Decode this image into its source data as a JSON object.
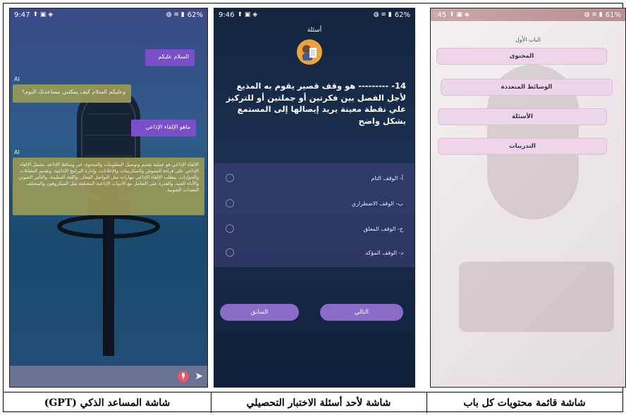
{
  "panels": {
    "chat": {
      "status": {
        "time": "9:47",
        "battery": "62%"
      },
      "messages": [
        {
          "role": "user",
          "text": "السلام عليكم"
        },
        {
          "role": "ai",
          "tag": "AI",
          "text": "وعليكم السلام كيف يمكنني مساعدتك اليوم؟"
        },
        {
          "role": "user",
          "text": "ماهو الإلقاء الإذاعي"
        },
        {
          "role": "ai",
          "tag": "AI",
          "text": "الإلقاء الإذاعي هو عملية تقديم وتوصيل المعلومات والمحتوى عبر وسائط الإذاعة. يشمل الإلقاء الإذاعي على قراءة النصوص والسكريبتات والإعلانات، وإدارة البرامج الإذاعية، وتقديم المقابلات والحوارات. يتطلب الإلقاء الإذاعي مهارات مثل التواصل الفعال، واللغة السليمة، والتأثير الصوتي والأداء الجيد، والقدرة على التعامل مع الأدوات الإذاعية المختلفة مثل الميكروفون والمختلف المعدات الصوتية."
        }
      ],
      "input_placeholder": "Type here"
    },
    "quiz": {
      "status": {
        "time": "9:46",
        "battery": "62%"
      },
      "title": "أسئلة",
      "question": "14- --------- هو وقف قصير يقوم به المذيع لأجل الفصل بين فكرتين أو جملتين أو للتركيز علي نقطة معينة يريد إيصالها إلى المستمع بشكل واضح",
      "options": [
        "أ- الوقف التام",
        "ب- الوقف الاضطراري",
        "ج- الوقف المعلق",
        "د- الوقف المؤكد"
      ],
      "next_label": "التالي",
      "prev_label": "السابق"
    },
    "menu": {
      "status": {
        "time": ":45",
        "battery": "61%"
      },
      "title": "الباب الأول",
      "items": [
        "المحتوى",
        "الوسائط المتعددة",
        "الأسئلة",
        "التدريبات"
      ]
    }
  },
  "captions": [
    "شاشة المساعد الذكي (GPT)",
    "شاشة لأحد أسئلة الاختبار التحصيلي",
    "شاشة قائمة محتويات كل باب"
  ]
}
